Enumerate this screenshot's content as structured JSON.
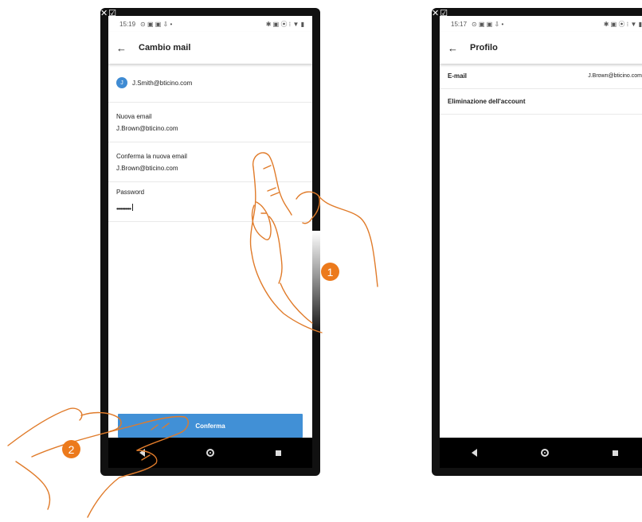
{
  "left_phone": {
    "status_time": "15:19",
    "title": "Cambio mail",
    "user": {
      "initial": "J",
      "email": "J.Smith@bticino.com"
    },
    "fields": [
      {
        "label": "Nuova email",
        "value": "J.Brown@bticino.com"
      },
      {
        "label": "Conferma la nuova email",
        "value": "J.Brown@bticino.com"
      }
    ],
    "password": {
      "label": "Password",
      "value": "••••••••••"
    },
    "confirm_label": "Conferma"
  },
  "right_phone": {
    "status_time": "15:17",
    "title": "Profilo",
    "rows": [
      {
        "label": "E-mail",
        "value": "J.Brown@bticino.com"
      },
      {
        "label": "Eliminazione dell'account",
        "value": ""
      }
    ]
  },
  "steps": [
    "1",
    "2"
  ],
  "colors": {
    "accent": "#4190d6",
    "step_badge": "#ec7a1c",
    "hand_stroke": "#e07b2a"
  },
  "icons": {
    "back": "arrow-left-icon",
    "status": [
      "bluetooth-icon",
      "vibrate-icon",
      "location-icon",
      "wifi-icon",
      "battery-icon"
    ],
    "nav": [
      "back-triangle-icon",
      "home-circle-icon",
      "recent-square-icon"
    ]
  }
}
